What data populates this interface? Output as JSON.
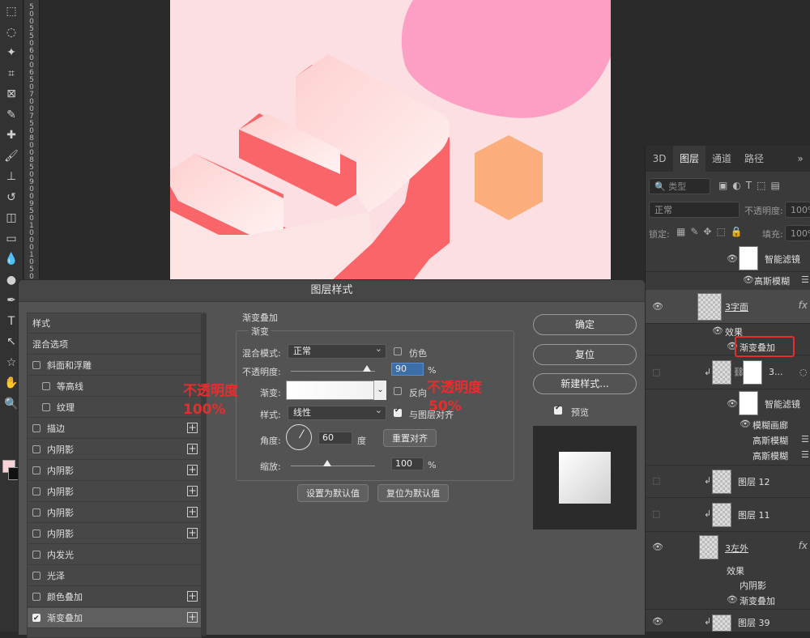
{
  "toolbar": {
    "tools": [
      "marquee-tool",
      "lasso-tool",
      "magic-wand-tool",
      "crop-tool",
      "frame-tool",
      "eyedropper-tool",
      "healing-brush-tool",
      "brush-tool",
      "clone-stamp-tool",
      "history-brush-tool",
      "eraser-tool",
      "gradient-tool",
      "blur-tool",
      "dodge-tool",
      "pen-tool",
      "type-tool",
      "path-selection-tool",
      "shape-tool",
      "hand-tool",
      "zoom-tool"
    ],
    "icons": [
      "⬚",
      "◌",
      "✦",
      "⌗",
      "⊠",
      "✎",
      "✚",
      "🖌",
      "⊥",
      "↺",
      "◫",
      "▭",
      "💧",
      "●",
      "✒",
      "T",
      "↖",
      "☆",
      "✋",
      "🔍"
    ]
  },
  "ruler": {
    "digits": [
      "5",
      "0",
      "0",
      "5",
      "5",
      "0",
      "6",
      "0",
      "0",
      "6",
      "5",
      "0",
      "7",
      "0",
      "0",
      "7",
      "5",
      "0",
      "8",
      "0",
      "0",
      "8",
      "5",
      "0",
      "9",
      "0",
      "0",
      "9",
      "5",
      "0",
      "1",
      "0",
      "0",
      "0",
      "1",
      "0",
      "5",
      "0"
    ]
  },
  "canvas": {
    "colors": {
      "background": "#fcdfe3",
      "blob": "#fd9ec4",
      "hexagon": "#fcad7c",
      "letter_side": "#fa6569",
      "letter_face": "#fde8e8"
    }
  },
  "layers_panel": {
    "tabs": [
      "3D",
      "图层",
      "通道",
      "路径"
    ],
    "active_tab": "图层",
    "more": "»",
    "kind_filter": "类型",
    "blend_mode": "正常",
    "opacity_label": "不透明度:",
    "opacity_value": "100%",
    "lock_label": "锁定:",
    "fill_label": "填充:",
    "fill_value": "100%",
    "rows": {
      "smart_filter_1": "智能滤镜",
      "gaussian_blur_1": "高斯模糊",
      "layer_3_front": "3字面",
      "effects_1": "效果",
      "gradient_overlay_1": "渐变叠加",
      "layer_3_dots": "3...",
      "smart_filter_2": "智能滤镜",
      "motion_blur": "模糊画廊",
      "gaussian_blur_2": "高斯模糊",
      "gaussian_blur_3": "高斯模糊",
      "layer_12": "图层 12",
      "layer_11": "图层 11",
      "layer_3_left": "3左外",
      "effects_2": "效果",
      "inner_shadow": "内阴影",
      "gradient_overlay_2": "渐变叠加",
      "layer_39": "图层 39",
      "fx": "fx"
    }
  },
  "dialog": {
    "title": "图层样式",
    "style_list": [
      {
        "label": "样式",
        "check": false,
        "plus": false,
        "indent": 0,
        "checked": false
      },
      {
        "label": "混合选项",
        "check": false,
        "plus": false,
        "indent": 0,
        "checked": false
      },
      {
        "label": "斜面和浮雕",
        "check": true,
        "plus": false,
        "indent": 0,
        "checked": false
      },
      {
        "label": "等高线",
        "check": true,
        "plus": false,
        "indent": 1,
        "checked": false
      },
      {
        "label": "纹理",
        "check": true,
        "plus": false,
        "indent": 1,
        "checked": false
      },
      {
        "label": "描边",
        "check": true,
        "plus": true,
        "indent": 0,
        "checked": false
      },
      {
        "label": "内阴影",
        "check": true,
        "plus": true,
        "indent": 0,
        "checked": false
      },
      {
        "label": "内阴影",
        "check": true,
        "plus": true,
        "indent": 0,
        "checked": false
      },
      {
        "label": "内阴影",
        "check": true,
        "plus": true,
        "indent": 0,
        "checked": false
      },
      {
        "label": "内阴影",
        "check": true,
        "plus": true,
        "indent": 0,
        "checked": false
      },
      {
        "label": "内阴影",
        "check": true,
        "plus": true,
        "indent": 0,
        "checked": false
      },
      {
        "label": "内发光",
        "check": true,
        "plus": false,
        "indent": 0,
        "checked": false
      },
      {
        "label": "光泽",
        "check": true,
        "plus": false,
        "indent": 0,
        "checked": false
      },
      {
        "label": "颜色叠加",
        "check": true,
        "plus": true,
        "indent": 0,
        "checked": false
      },
      {
        "label": "渐变叠加",
        "check": true,
        "plus": true,
        "indent": 0,
        "checked": true
      }
    ],
    "section_title": "渐变叠加",
    "group_title": "渐变",
    "blend_mode_label": "混合模式:",
    "blend_mode_value": "正常",
    "dither_label": "仿色",
    "opacity_label": "不透明度:",
    "opacity_value": "90",
    "percent": "%",
    "opacity_fraction": 0.9,
    "gradient_label": "渐变:",
    "reverse_label": "反向",
    "style_label": "样式:",
    "style_value": "线性",
    "align_label": "与图层对齐",
    "angle_label": "角度:",
    "angle_value": "60",
    "degree": "度",
    "reset_align": "重置对齐",
    "scale_label": "缩放:",
    "scale_value": "100",
    "scale_fraction": 0.43,
    "set_default": "设置为默认值",
    "reset_default": "复位为默认值",
    "ok": "确定",
    "reset": "复位",
    "new_style": "新建样式...",
    "preview_label": "预览"
  },
  "annotations": {
    "left_line1": "不透明度",
    "left_line2": "100%",
    "right_line1": "不透明度",
    "right_line2": "50%",
    "color": "#e62e2e"
  }
}
